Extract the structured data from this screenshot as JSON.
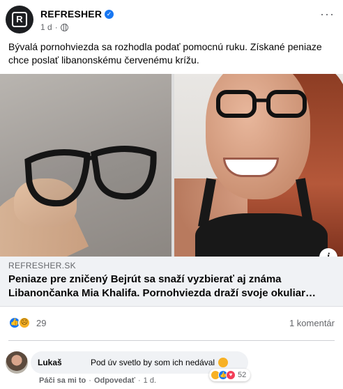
{
  "post": {
    "page_name": "REFRESHER",
    "logo_letter": "R",
    "verified_icon": "verified-badge-icon",
    "time": "1 d",
    "time_sep": "·",
    "privacy_icon": "globe-icon",
    "more_label": "···",
    "caption": "Bývalá pornohviezda sa rozhodla podať pomocnú ruku. Získané peniaze chce poslať libanonskému červenému krížu."
  },
  "link_preview": {
    "domain": "REFRESHER.SK",
    "title": "Peniaze pre zničený Bejrút sa snaží vyzbierať aj známa Libanončanka Mia Khalifa. Pornohviezda draží svoje okuliar…",
    "info_label": "i"
  },
  "reactions": {
    "icons": [
      "like-icon",
      "sad-icon"
    ],
    "count": "29",
    "comments": "1 komentár"
  },
  "comment": {
    "author": "Lukaš",
    "text": "Pod úv svetlo by som ich nedával",
    "reaction_count": "52",
    "reaction_icons": [
      "haha-icon",
      "like-icon",
      "love-icon"
    ],
    "like_action": "Páči sa mi to",
    "sep": "·",
    "reply_action": "Odpovedať",
    "time": "1 d."
  },
  "colors": {
    "accent": "#1877f2",
    "secondary_text": "#65676b",
    "link_bg": "#f0f2f5"
  }
}
